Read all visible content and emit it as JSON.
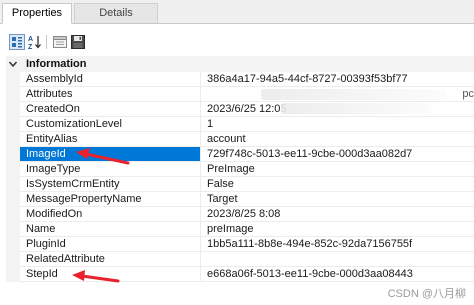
{
  "tabs": [
    {
      "label": "Properties"
    },
    {
      "label": "Details"
    }
  ],
  "toolbar": {
    "buttons": [
      {
        "icon": "categorized-icon"
      },
      {
        "icon": "alphabetical-sort-icon"
      },
      {
        "icon": "property-pages-icon"
      },
      {
        "icon": "save-icon"
      }
    ]
  },
  "grid": {
    "category": "Information",
    "rows": [
      {
        "name": "AssemblyId",
        "value": "386a4a17-94a5-44cf-8727-00393f53bf77"
      },
      {
        "name": "Attributes",
        "value": "",
        "value_tail": "pc"
      },
      {
        "name": "CreatedOn",
        "value": "2023/6/25 12:05"
      },
      {
        "name": "CustomizationLevel",
        "value": "1"
      },
      {
        "name": "EntityAlias",
        "value": "account"
      },
      {
        "name": "ImageId",
        "value": "729f748c-5013-ee11-9cbe-000d3aa082d7",
        "selected": true
      },
      {
        "name": "ImageType",
        "value": "PreImage"
      },
      {
        "name": "IsSystemCrmEntity",
        "value": "False"
      },
      {
        "name": "MessagePropertyName",
        "value": "Target"
      },
      {
        "name": "ModifiedOn",
        "value": "2023/8/25 8:08"
      },
      {
        "name": "Name",
        "value": "preImage"
      },
      {
        "name": "PluginId",
        "value": "1bb5a111-8b8e-494e-852c-92da7156755f"
      },
      {
        "name": "RelatedAttribute",
        "value": ""
      },
      {
        "name": "StepId",
        "value": "e668a06f-5013-ee11-9cbe-000d3aa08443"
      }
    ]
  },
  "colors": {
    "selection": "#0078d7",
    "annotation_arrow": "#e8212c"
  },
  "watermark": "CSDN @八月柳"
}
